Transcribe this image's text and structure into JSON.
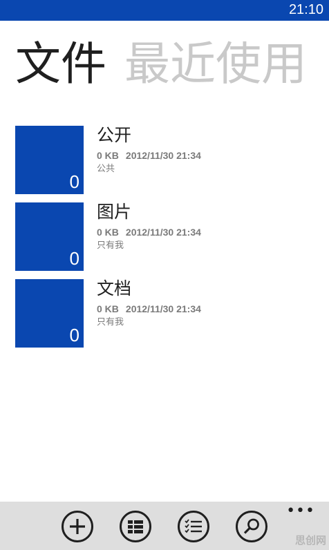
{
  "status_bar": {
    "time": "21:10"
  },
  "pivot": {
    "active": "文件",
    "inactive": "最近使用"
  },
  "folders": [
    {
      "name": "公开",
      "count": "0",
      "size": "0 KB",
      "date": "2012/11/30 21:34",
      "sharing": "公共"
    },
    {
      "name": "图片",
      "count": "0",
      "size": "0 KB",
      "date": "2012/11/30 21:34",
      "sharing": "只有我"
    },
    {
      "name": "文档",
      "count": "0",
      "size": "0 KB",
      "date": "2012/11/30 21:34",
      "sharing": "只有我"
    }
  ],
  "app_bar": {
    "buttons": [
      "add-icon",
      "tiles-view-icon",
      "list-select-icon",
      "search-icon"
    ],
    "more": "•••"
  },
  "watermark": "思创网",
  "colors": {
    "accent": "#0a47b0",
    "app_bar": "#dedede",
    "pivot_inactive": "#c9c9c9"
  }
}
